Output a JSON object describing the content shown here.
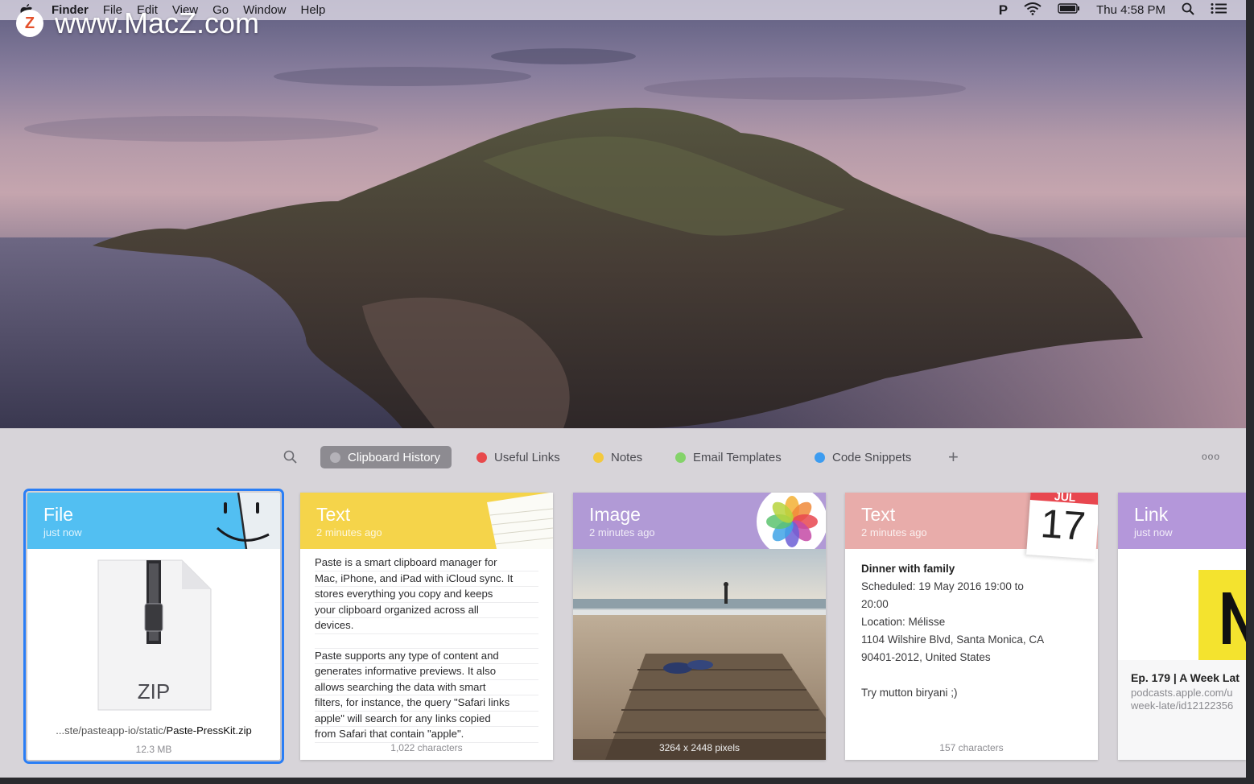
{
  "watermark": {
    "badge": "Z",
    "text": "www.MacZ.com"
  },
  "menubar": {
    "app_name": "Finder",
    "menus": [
      "File",
      "Edit",
      "View",
      "Go",
      "Window",
      "Help"
    ],
    "status_letter": "P",
    "clock": "Thu 4:58 PM"
  },
  "toolbar": {
    "tabs": [
      {
        "label": "Clipboard History",
        "color": "#b4b2b8"
      },
      {
        "label": "Useful Links",
        "color": "#e8494c"
      },
      {
        "label": "Notes",
        "color": "#f3c93e"
      },
      {
        "label": "Email Templates",
        "color": "#84d36a"
      },
      {
        "label": "Code Snippets",
        "color": "#3d9cf0"
      }
    ],
    "add_label": "+",
    "more_label": "ooo"
  },
  "cards": {
    "file": {
      "type": "File",
      "time": "just now",
      "color": "#52bff2",
      "file_label": "ZIP",
      "path_prefix": "...ste/pasteapp-io/static/",
      "path_file": "Paste-PressKit.zip",
      "size": "12.3 MB"
    },
    "text1": {
      "type": "Text",
      "time": "2 minutes ago",
      "color": "#f5d44a",
      "lines_a": [
        "Paste is a smart clipboard manager for",
        "Mac, iPhone, and iPad with iCloud sync. It",
        "stores everything you copy and keeps",
        "your clipboard organized across all",
        "devices."
      ],
      "lines_b": [
        "Paste supports any type of content and",
        "generates informative previews. It also",
        "allows searching the data with smart",
        "filters, for instance, the query \"Safari links",
        "apple\" will search for any links copied",
        "from Safari that contain \"apple\"."
      ],
      "footer": "1,022 characters"
    },
    "image": {
      "type": "Image",
      "time": "2 minutes ago",
      "color": "#b19ad6",
      "footer": "3264 x 2448 pixels"
    },
    "text2": {
      "type": "Text",
      "time": "2 minutes ago",
      "color": "#e8acaa",
      "calendar_month": "JUL",
      "calendar_day": "17",
      "title": "Dinner with family",
      "lines": [
        "Scheduled: 19 May 2016 19:00 to",
        "20:00",
        "Location: Mélisse",
        "1104 Wilshire Blvd, Santa Monica, CA",
        "90401-2012, United States"
      ],
      "note": "Try mutton biryani ;)",
      "footer": "157 characters"
    },
    "link": {
      "type": "Link",
      "time": "just now",
      "color": "#b497da",
      "title": "Ep. 179 | A Week Lat",
      "url_line1": "podcasts.apple.com/u",
      "url_line2": "week-late/id12122356"
    }
  }
}
